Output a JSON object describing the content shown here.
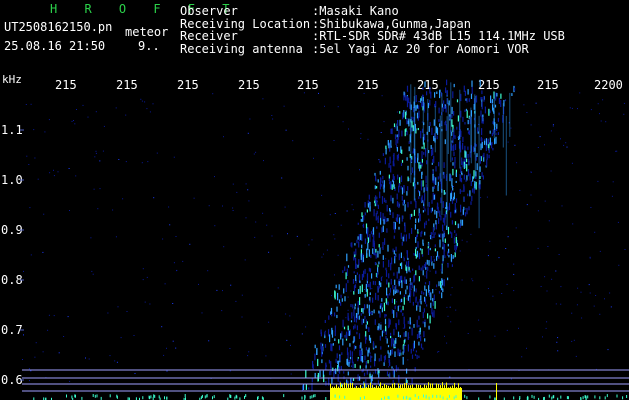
{
  "header": {
    "brand": "H R O F F T",
    "file_name": "UT2508162150.pn",
    "file_tag": "meteor",
    "date_time": "25.08.16 21:50",
    "range": "9..",
    "meta": {
      "labels": [
        "Observer",
        "Receiving Location",
        "Receiver",
        "Receiving antenna"
      ],
      "values": [
        ":Masaki Kano",
        ":Shibukawa,Gunma,Japan",
        ":RTL-SDR SDR# 43dB L15 114.1MHz USB",
        ":5el Yagi Az 20 for Aomori VOR"
      ]
    }
  },
  "axes": {
    "y_unit": "kHz",
    "y_ticks": [
      "1.1",
      "1.0",
      "0.9",
      "0.8",
      "0.7",
      "0.6"
    ],
    "x_ticks": [
      "215",
      "215",
      "215",
      "215",
      "215",
      "215",
      "215",
      "215",
      "215",
      "2200"
    ]
  },
  "colors": {
    "background": "#000000",
    "text": "#ffffff",
    "brand": "#2bd24a",
    "signal_low": "#0a1a9a",
    "signal_mid": "#2fa0ff",
    "signal_high": "#3cffd0",
    "carrier": "#ffff00",
    "ref_lines": "#9fa0ff"
  }
}
